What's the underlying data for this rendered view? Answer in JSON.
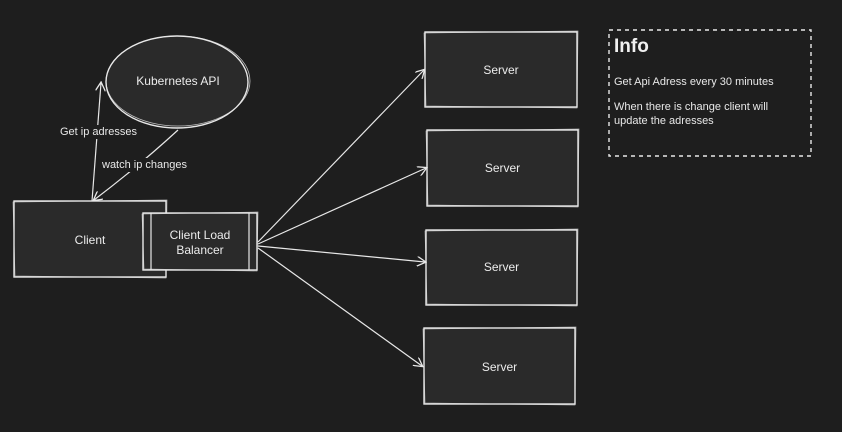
{
  "nodes": {
    "kubernetes_api": "Kubernetes API",
    "client": "Client",
    "client_load_balancer": "Client Load\nBalancer",
    "servers": [
      "Server",
      "Server",
      "Server",
      "Server"
    ]
  },
  "edges": {
    "get_ip": "Get ip adresses",
    "watch_ip": "watch ip changes"
  },
  "info": {
    "title": "Info",
    "line1": "Get Api Adress every 30 minutes",
    "line2": "When there is change client will update the adresses"
  }
}
